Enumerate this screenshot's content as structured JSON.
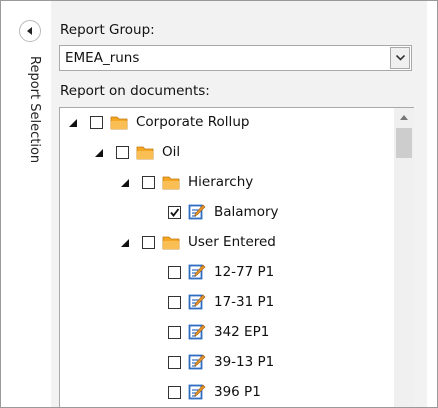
{
  "sidebar": {
    "title": "Report Selection"
  },
  "report_group": {
    "label": "Report Group:",
    "value": "EMEA_runs"
  },
  "documents": {
    "label": "Report on documents:"
  },
  "tree": [
    {
      "label": "Corporate Rollup",
      "type": "folder",
      "expanded": true,
      "checked": false
    },
    {
      "label": "Oil",
      "type": "folder",
      "expanded": true,
      "checked": false
    },
    {
      "label": "Hierarchy",
      "type": "folder",
      "expanded": true,
      "checked": false
    },
    {
      "label": "Balamory",
      "type": "document",
      "checked": true
    },
    {
      "label": "User Entered",
      "type": "folder",
      "expanded": true,
      "checked": false
    },
    {
      "label": "12-77 P1",
      "type": "document",
      "checked": false
    },
    {
      "label": "17-31 P1",
      "type": "document",
      "checked": false
    },
    {
      "label": "342 EP1",
      "type": "document",
      "checked": false
    },
    {
      "label": "39-13 P1",
      "type": "document",
      "checked": false
    },
    {
      "label": "396 P1",
      "type": "document",
      "checked": false
    }
  ],
  "colors": {
    "folder": "#f5a623",
    "doc_icon": "#2f6fc1",
    "accent_pencil": "#e8962c"
  },
  "icons": {
    "collapse": "triangle-left-icon",
    "dropdown": "chevron-down-icon",
    "expander": "expanded-triangle-icon",
    "folder": "folder-icon",
    "document": "document-edit-icon"
  }
}
